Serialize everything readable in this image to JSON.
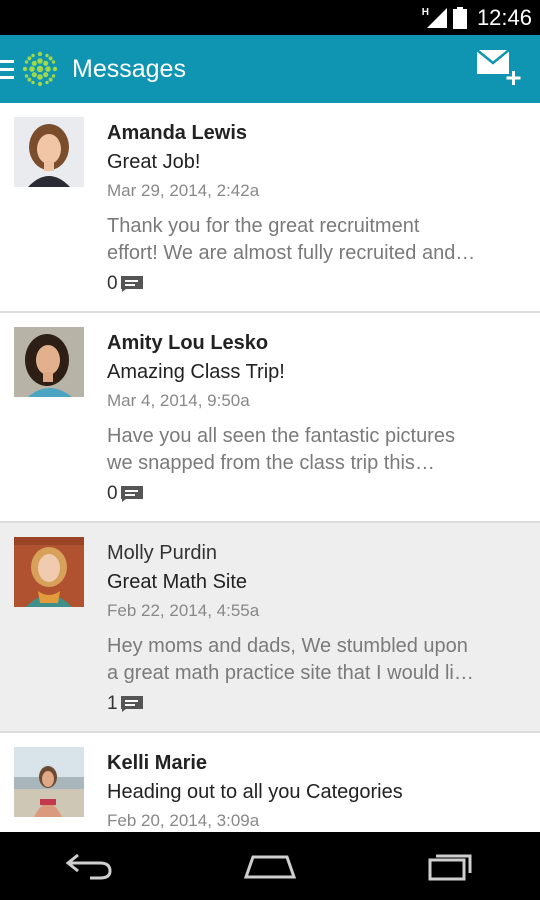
{
  "status_bar": {
    "network_type": "H",
    "time": "12:46"
  },
  "action_bar": {
    "title": "Messages",
    "accent_color": "#0f95b1"
  },
  "messages": [
    {
      "sender": "Amanda Lewis",
      "subject": "Great Job!",
      "date": "Mar 29, 2014, 2:42a",
      "preview_line1": "Thank you for the great recruitment",
      "preview_line2": "effort!  We are almost fully recruited and…",
      "reply_count": "0",
      "read": false
    },
    {
      "sender": "Amity Lou Lesko",
      "subject": "Amazing Class Trip!",
      "date": "Mar 4, 2014, 9:50a",
      "preview_line1": "Have you all seen the fantastic pictures",
      "preview_line2": "we snapped from the class trip this…",
      "reply_count": "0",
      "read": false
    },
    {
      "sender": "Molly Purdin",
      "subject": "Great Math Site",
      "date": "Feb 22, 2014, 4:55a",
      "preview_line1": "Hey moms and dads,  We stumbled upon",
      "preview_line2": "a great math practice site that I would li…",
      "reply_count": "1",
      "read": true
    },
    {
      "sender": "Kelli Marie",
      "subject": "Heading out to all you Categories",
      "date": "Feb 20, 2014, 3:09a",
      "preview_line1": "",
      "preview_line2": "",
      "reply_count": "",
      "read": false
    }
  ]
}
